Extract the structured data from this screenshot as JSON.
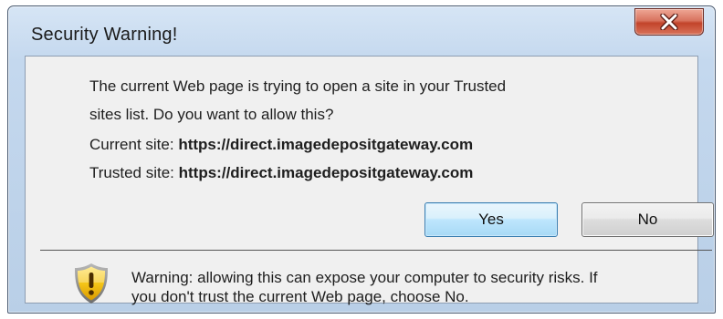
{
  "dialog": {
    "title": "Security Warning!",
    "close_label": "X",
    "message_line1": "The current Web page is trying to open a site in your Trusted",
    "message_line2": "sites list. Do you want to allow this?",
    "current_site_label": "Current site: ",
    "current_site_url": "https://direct.imagedepositgateway.com",
    "trusted_site_label": "Trusted site: ",
    "trusted_site_url": "https://direct.imagedepositgateway.com",
    "yes_label": "Yes",
    "no_label": "No",
    "warning_line1": "Warning: allowing this can expose your computer to security risks. If",
    "warning_line2": "you don't trust the current Web page, choose No."
  },
  "icons": {
    "close": "close-icon",
    "warning": "warning-shield-icon"
  },
  "colors": {
    "title_bar": "#c4d8ee",
    "close_button": "#c2432a",
    "client_background": "#f0f0f0",
    "default_button_border": "#3c7fb1",
    "shield_yellow": "#f5c518"
  }
}
